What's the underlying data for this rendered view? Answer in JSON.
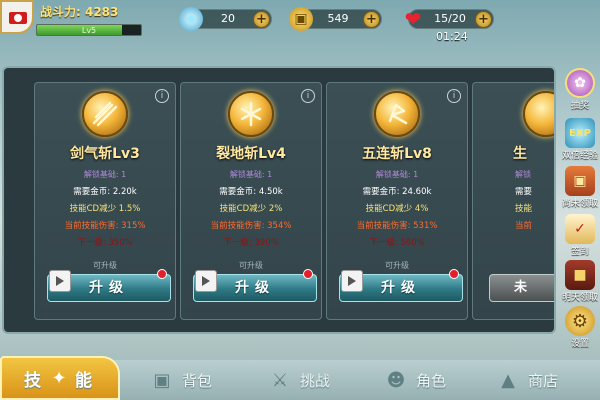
{
  "header": {
    "power_label": "战斗力: 4283",
    "level_text": "Lv5",
    "gems": "20",
    "gold": "549",
    "stamina": "15/20",
    "timer": "01:24"
  },
  "cards": [
    {
      "name": "剑气斩Lv3",
      "unlock": "解锁基础: 1",
      "cost": "需要金币: 2.20k",
      "cd": "技能CD减少 1.5%",
      "damage": "当前技能伤害: 315%",
      "next": "下一级: 350%",
      "status": "可升级",
      "button": "升级"
    },
    {
      "name": "裂地斩Lv4",
      "unlock": "解锁基础: 1",
      "cost": "需要金币: 4.50k",
      "cd": "技能CD减少 2%",
      "damage": "当前技能伤害: 354%",
      "next": "下一级: 390%",
      "status": "可升级",
      "button": "升级"
    },
    {
      "name": "五连斩Lv8",
      "unlock": "解锁基础: 1",
      "cost": "需要金币: 24.60k",
      "cd": "技能CD减少 4%",
      "damage": "当前技能伤害: 531%",
      "next": "下一级: 560%",
      "status": "可升级",
      "button": "升级"
    },
    {
      "name": "生",
      "unlock": "解锁",
      "cost": "需要",
      "cd": "技能",
      "damage": "当前",
      "button": "未"
    }
  ],
  "sidebar": [
    {
      "label": "抽奖",
      "icon": "lottery-icon"
    },
    {
      "label": "双倍经验",
      "icon": "exp-icon"
    },
    {
      "label": "尚未领取",
      "icon": "gift-icon"
    },
    {
      "label": "签到",
      "icon": "scroll-icon"
    },
    {
      "label": "明天领取",
      "icon": "chest-icon"
    },
    {
      "label": "设置",
      "icon": "gear-icon"
    }
  ],
  "tabs": [
    {
      "label": "技",
      "label2": "能",
      "icon": "skill-icon",
      "active": true
    },
    {
      "label": "背包",
      "icon": "backpack-icon"
    },
    {
      "label": "挑战",
      "icon": "swords-icon"
    },
    {
      "label": "角色",
      "icon": "character-icon"
    },
    {
      "label": "商店",
      "icon": "shop-icon"
    }
  ],
  "colors": {
    "panel_bg": "#2b3a3f",
    "button_teal": "#2e7985",
    "active_tab": "#f3c542",
    "damage_text": "#ff6a2d",
    "cd_text": "#f3e37a"
  }
}
